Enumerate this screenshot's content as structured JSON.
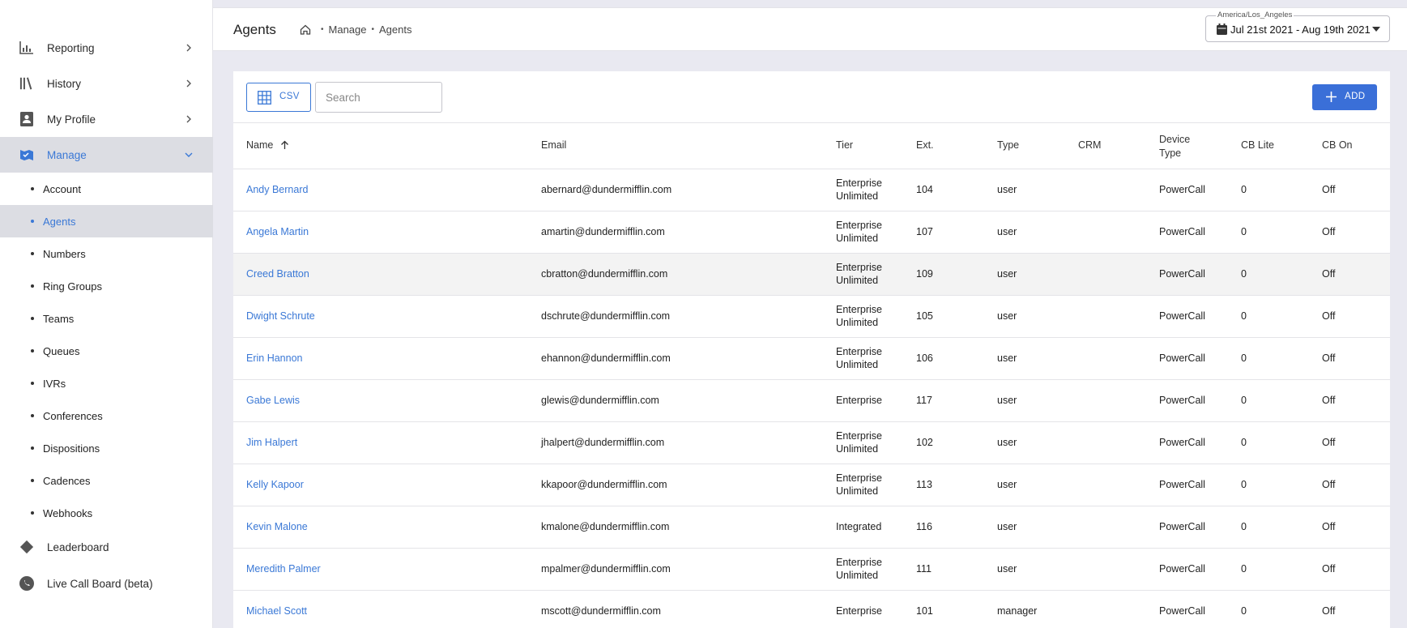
{
  "sidebar": {
    "nav": [
      {
        "label": "Reporting",
        "icon": "bar-chart-icon"
      },
      {
        "label": "History",
        "icon": "library-icon"
      },
      {
        "label": "My Profile",
        "icon": "profile-icon"
      },
      {
        "label": "Manage",
        "icon": "manage-icon"
      }
    ],
    "manage_items": [
      "Account",
      "Agents",
      "Numbers",
      "Ring Groups",
      "Teams",
      "Queues",
      "IVRs",
      "Conferences",
      "Dispositions",
      "Cadences",
      "Webhooks"
    ],
    "bottom": [
      {
        "label": "Leaderboard",
        "icon": "diamond-icon"
      },
      {
        "label": "Live Call Board (beta)",
        "icon": "phone-icon"
      }
    ]
  },
  "header": {
    "title": "Agents",
    "breadcrumb": [
      "Manage",
      "Agents"
    ],
    "date_timezone": "America/Los_Angeles",
    "date_range": "Jul 21st 2021 - Aug 19th 2021"
  },
  "toolbar": {
    "csv_label": "CSV",
    "search_placeholder": "Search",
    "add_label": "ADD"
  },
  "table": {
    "columns": [
      "Name",
      "Email",
      "Tier",
      "Ext.",
      "Type",
      "CRM",
      "Device Type",
      "CB Lite",
      "CB On"
    ],
    "column_lines": {
      "device_type": [
        "Device",
        "Type"
      ]
    },
    "rows": [
      {
        "name": "Andy Bernard",
        "email": "abernard@dundermifflin.com",
        "tier": [
          "Enterprise",
          "Unlimited"
        ],
        "ext": "104",
        "type": "user",
        "crm": "",
        "device": "PowerCall",
        "cb_lite": "0",
        "cb_on": "Off"
      },
      {
        "name": "Angela Martin",
        "email": "amartin@dundermifflin.com",
        "tier": [
          "Enterprise",
          "Unlimited"
        ],
        "ext": "107",
        "type": "user",
        "crm": "",
        "device": "PowerCall",
        "cb_lite": "0",
        "cb_on": "Off"
      },
      {
        "name": "Creed Bratton",
        "email": "cbratton@dundermifflin.com",
        "tier": [
          "Enterprise",
          "Unlimited"
        ],
        "ext": "109",
        "type": "user",
        "crm": "",
        "device": "PowerCall",
        "cb_lite": "0",
        "cb_on": "Off"
      },
      {
        "name": "Dwight Schrute",
        "email": "dschrute@dundermifflin.com",
        "tier": [
          "Enterprise",
          "Unlimited"
        ],
        "ext": "105",
        "type": "user",
        "crm": "",
        "device": "PowerCall",
        "cb_lite": "0",
        "cb_on": "Off"
      },
      {
        "name": "Erin Hannon",
        "email": "ehannon@dundermifflin.com",
        "tier": [
          "Enterprise",
          "Unlimited"
        ],
        "ext": "106",
        "type": "user",
        "crm": "",
        "device": "PowerCall",
        "cb_lite": "0",
        "cb_on": "Off"
      },
      {
        "name": "Gabe Lewis",
        "email": "glewis@dundermifflin.com",
        "tier": [
          "Enterprise"
        ],
        "ext": "117",
        "type": "user",
        "crm": "",
        "device": "PowerCall",
        "cb_lite": "0",
        "cb_on": "Off"
      },
      {
        "name": "Jim Halpert",
        "email": "jhalpert@dundermifflin.com",
        "tier": [
          "Enterprise",
          "Unlimited"
        ],
        "ext": "102",
        "type": "user",
        "crm": "",
        "device": "PowerCall",
        "cb_lite": "0",
        "cb_on": "Off"
      },
      {
        "name": "Kelly Kapoor",
        "email": "kkapoor@dundermifflin.com",
        "tier": [
          "Enterprise",
          "Unlimited"
        ],
        "ext": "113",
        "type": "user",
        "crm": "",
        "device": "PowerCall",
        "cb_lite": "0",
        "cb_on": "Off"
      },
      {
        "name": "Kevin Malone",
        "email": "kmalone@dundermifflin.com",
        "tier": [
          "Integrated"
        ],
        "ext": "116",
        "type": "user",
        "crm": "",
        "device": "PowerCall",
        "cb_lite": "0",
        "cb_on": "Off"
      },
      {
        "name": "Meredith Palmer",
        "email": "mpalmer@dundermifflin.com",
        "tier": [
          "Enterprise",
          "Unlimited"
        ],
        "ext": "111",
        "type": "user",
        "crm": "",
        "device": "PowerCall",
        "cb_lite": "0",
        "cb_on": "Off"
      },
      {
        "name": "Michael Scott",
        "email": "mscott@dundermifflin.com",
        "tier": [
          "Enterprise"
        ],
        "ext": "101",
        "type": "manager",
        "crm": "",
        "device": "PowerCall",
        "cb_lite": "0",
        "cb_on": "Off"
      }
    ]
  },
  "colors": {
    "accent": "#3a78d6",
    "add_button": "#3a6fd8",
    "selected_bg": "#dcdde3",
    "page_bg": "#e9e9f1"
  }
}
